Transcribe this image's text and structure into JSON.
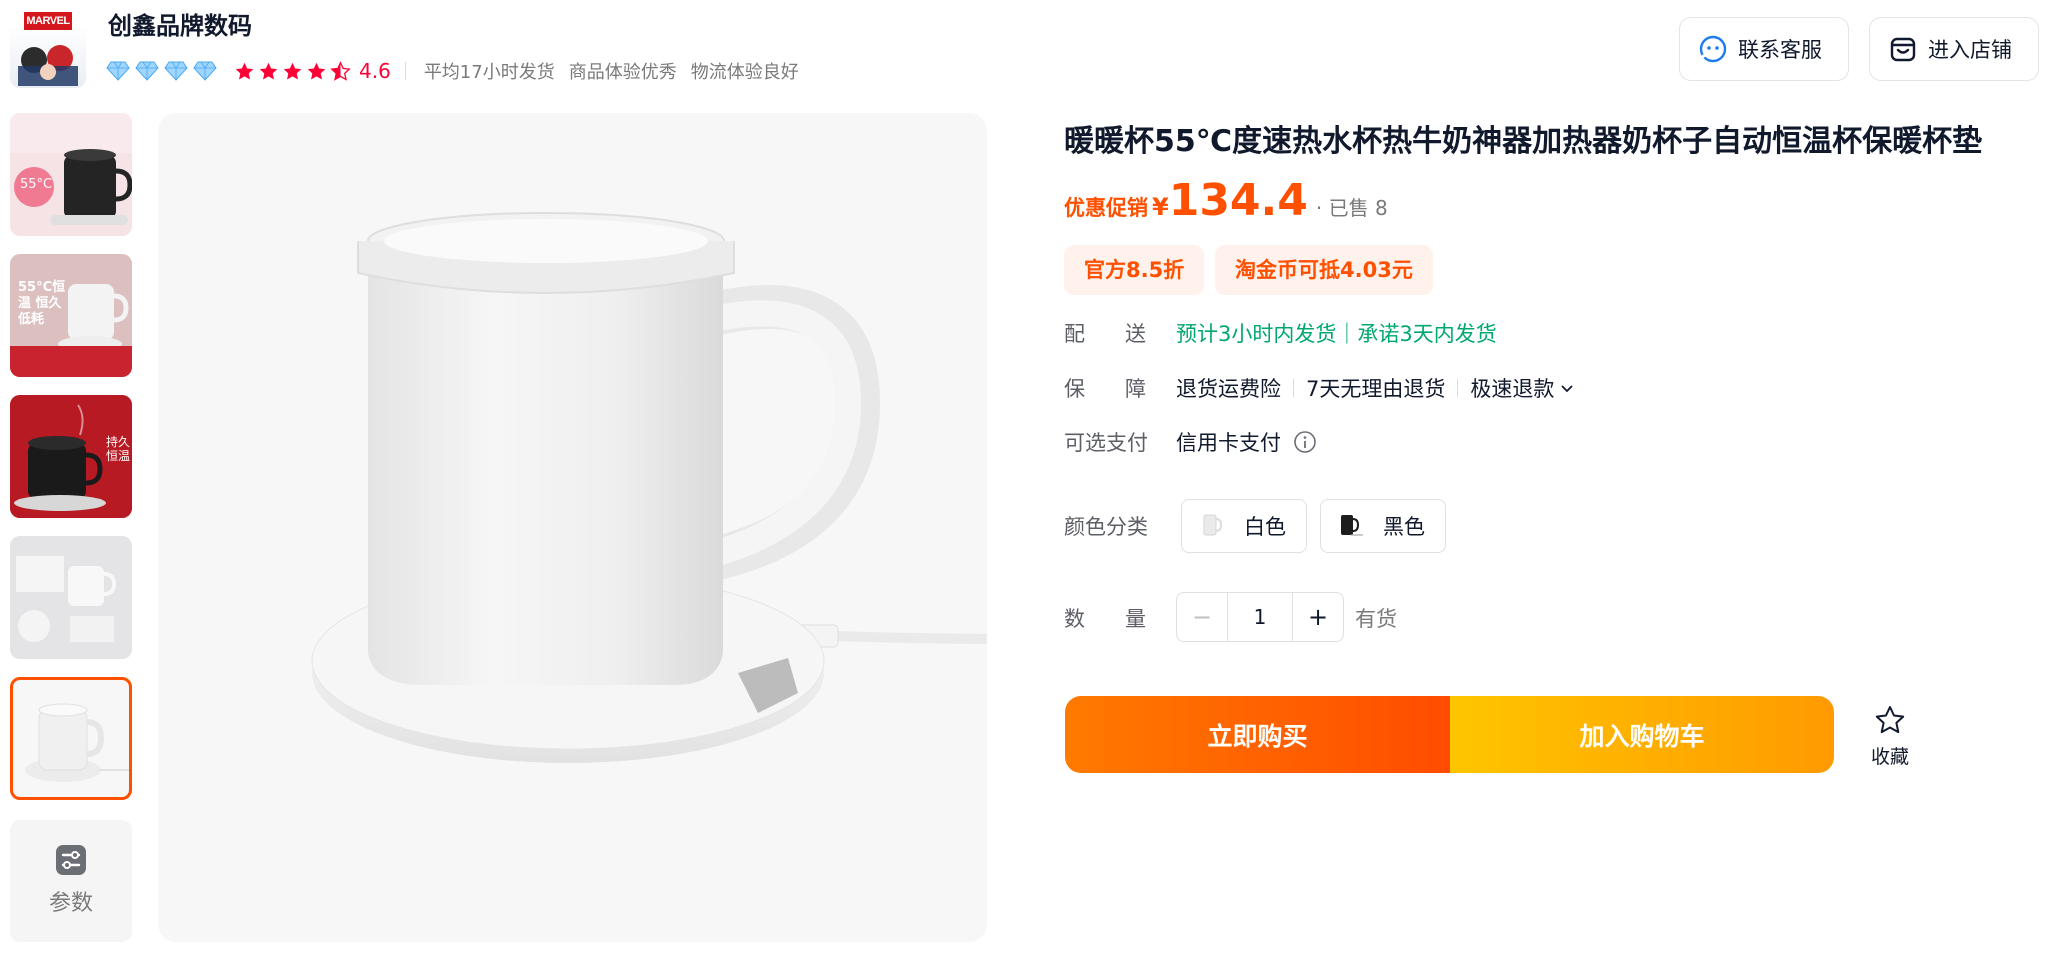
{
  "shop": {
    "name": "创鑫品牌数码",
    "logo_text": "MARVEL",
    "rating": "4.6",
    "metrics": [
      "平均17小时发货",
      "商品体验优秀",
      "物流体验良好"
    ],
    "diamond_count": 4,
    "star_count": 5
  },
  "header_buttons": {
    "service": "联系客服",
    "store": "进入店铺"
  },
  "gallery": {
    "thumbnails": [
      {
        "caption": "55°C"
      },
      {
        "caption": "55°C恒温 恒久低耗"
      },
      {
        "caption": "持久恒温"
      },
      {
        "caption": ""
      },
      {
        "caption": ""
      }
    ],
    "active_index": 4,
    "params_label": "参数"
  },
  "product": {
    "title": "暖暖杯55℃度速热水杯热牛奶神器加热器奶杯子自动恒温杯保暖杯垫",
    "promo_label": "优惠促销",
    "currency": "¥",
    "price": "134.4",
    "sold": "· 已售 8",
    "coupons": [
      "官方8.5折",
      "淘金币可抵4.03元"
    ],
    "shipping_label": "配送",
    "shipping": "预计3小时内发货｜承诺3天内发货",
    "guarantee_label": "保障",
    "guarantees": [
      "退货运费险",
      "7天无理由退货",
      "极速退款"
    ],
    "payment_label": "可选支付",
    "payment": "信用卡支付",
    "color_label": "颜色分类",
    "colors": [
      "白色",
      "黑色"
    ],
    "quantity_label": "数量",
    "quantity": "1",
    "minus": "−",
    "plus": "+",
    "stock": "有货"
  },
  "actions": {
    "buy_now": "立即购买",
    "add_cart": "加入购物车",
    "favorite": "收藏"
  },
  "colors": {
    "accent": "#ff5000",
    "rating_red": "#ff0036",
    "ship_green": "#00a870",
    "thumb_active": "#ff5000"
  }
}
